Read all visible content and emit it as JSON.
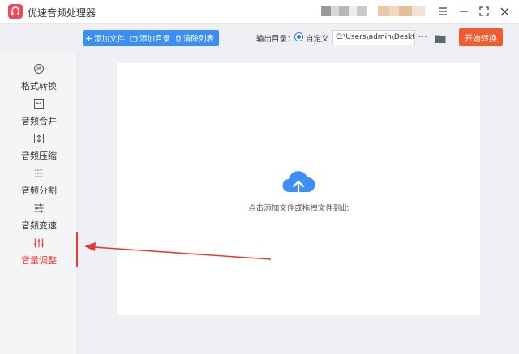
{
  "window": {
    "title": "优速音频处理器",
    "controls": [
      "menu-icon",
      "minimize-icon",
      "fullscreen-icon",
      "close-icon"
    ]
  },
  "sidebar": {
    "items": [
      {
        "label": "格式转换",
        "icon": "format-convert-icon",
        "active": false
      },
      {
        "label": "音频合并",
        "icon": "merge-icon",
        "active": false
      },
      {
        "label": "音频压缩",
        "icon": "compress-icon",
        "active": false
      },
      {
        "label": "音频分割",
        "icon": "split-icon",
        "active": false
      },
      {
        "label": "音频变速",
        "icon": "speed-icon",
        "active": false
      },
      {
        "label": "音量调整",
        "icon": "volume-adjust-icon",
        "active": true
      }
    ]
  },
  "toolbar": {
    "add_file": "添加文件",
    "add_folder": "添加目录",
    "clear_list": "清除列表",
    "output_label": "输出目录：",
    "custom_option": "自定义",
    "output_path": "C:\\Users\\admin\\Desktop",
    "more": "···",
    "start": "开始转换"
  },
  "main": {
    "drop_hint": "点击添加文件或拖拽文件到此"
  },
  "colors": {
    "accent_blue": "#3a8ff7",
    "accent_red": "#ef3b3b",
    "start_orange": "#f25b2d",
    "cloud_blue": "#3d8ff5"
  }
}
